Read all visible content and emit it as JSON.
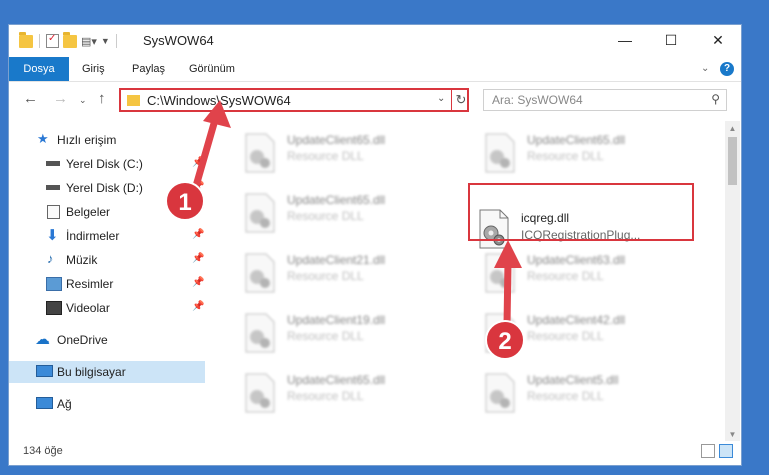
{
  "window": {
    "title": "SysWOW64"
  },
  "ribbon": {
    "tabs": [
      "Dosya",
      "Giriş",
      "Paylaş",
      "Görünüm"
    ]
  },
  "address": {
    "path": "C:\\Windows\\SysWOW64"
  },
  "search": {
    "placeholder": "Ara: SysWOW64"
  },
  "nav": {
    "items": [
      {
        "label": "Hızlı erişim",
        "icon": "star-icon"
      },
      {
        "label": "Yerel Disk (C:)",
        "icon": "drive-icon"
      },
      {
        "label": "Yerel Disk (D:)",
        "icon": "drive-icon"
      },
      {
        "label": "Belgeler",
        "icon": "documents-icon"
      },
      {
        "label": "İndirmeler",
        "icon": "download-icon"
      },
      {
        "label": "Müzik",
        "icon": "music-icon"
      },
      {
        "label": "Resimler",
        "icon": "pictures-icon"
      },
      {
        "label": "Videolar",
        "icon": "video-icon"
      },
      {
        "label": "OneDrive",
        "icon": "cloud-icon"
      },
      {
        "label": "Bu bilgisayar",
        "icon": "computer-icon"
      },
      {
        "label": "Ağ",
        "icon": "network-icon"
      }
    ]
  },
  "files": [
    {
      "name": "UpdateClient65.dll",
      "desc": "Resource DLL"
    },
    {
      "name": "UpdateClient65.dll",
      "desc": "Resource DLL"
    },
    {
      "name": "UpdateClient65.dll",
      "desc": "Resource DLL"
    },
    {
      "name": "icqreg.dll",
      "desc": "ICQRegistrationPlug..."
    },
    {
      "name": "UpdateClient21.dll",
      "desc": "Resource DLL"
    },
    {
      "name": "UpdateClient63.dll",
      "desc": "Resource DLL"
    },
    {
      "name": "UpdateClient19.dll",
      "desc": "Resource DLL"
    },
    {
      "name": "UpdateClient42.dll",
      "desc": "Resource DLL"
    },
    {
      "name": "UpdateClient65.dll",
      "desc": "Resource DLL"
    },
    {
      "name": "UpdateClient5.dll",
      "desc": "Resource DLL"
    }
  ],
  "status": {
    "count": "134 öğe"
  },
  "annotations": {
    "step1": "1",
    "step2": "2"
  },
  "colors": {
    "highlight": "#d9363e",
    "accent": "#1979ca"
  }
}
